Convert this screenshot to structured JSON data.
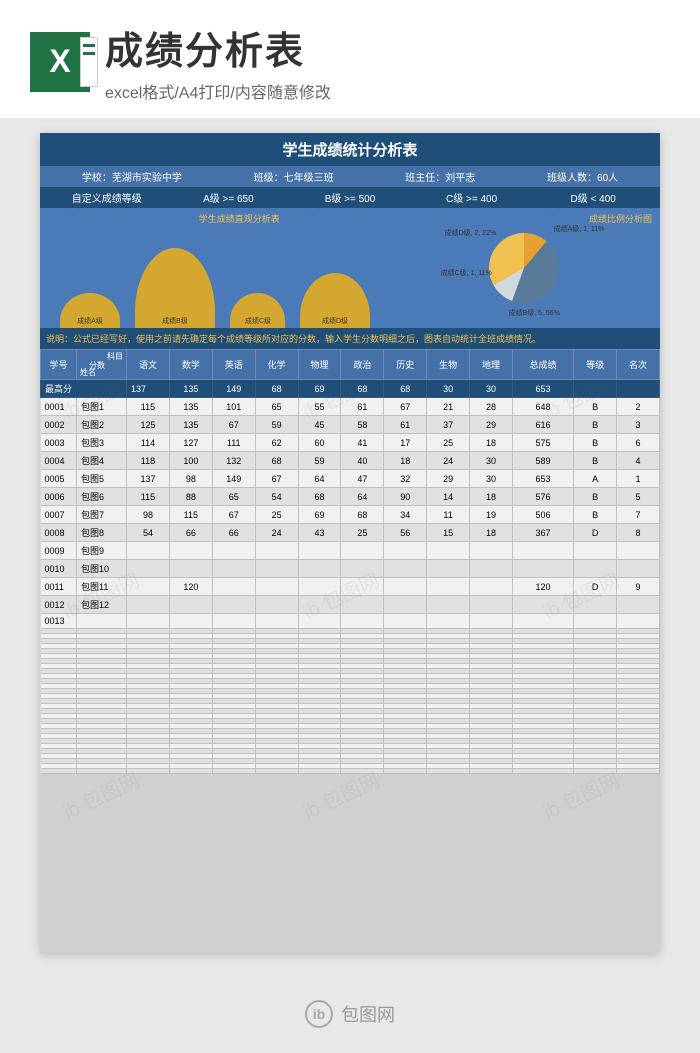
{
  "banner": {
    "title": "成绩分析表",
    "subtitle": "excel格式/A4打印/内容随意修改",
    "icon_letter": "X"
  },
  "sheet": {
    "title": "学生成绩统计分析表",
    "info": {
      "school_label": "学校：芜湖市实验中学",
      "class_label": "班级：七年级三班",
      "teacher_label": "班主任：刘平志",
      "count_label": "班级人数：60人"
    },
    "levels": {
      "custom": "自定义成绩等级",
      "a": "A级 >= 650",
      "b": "B级 >= 500",
      "c": "C级 >= 400",
      "d": "D级 < 400"
    },
    "chart": {
      "area_title": "学生成绩直观分析表",
      "pie_title": "成绩比例分析图",
      "pie_labels": {
        "a": "成绩A级, 1, 11%",
        "b": "成绩B级, 5, 56%",
        "c": "成绩C级, 1, 11%",
        "d": "成绩D级, 2, 22%"
      },
      "hump_labels": [
        "成绩A级",
        "成绩B级",
        "成绩C级",
        "成绩D级"
      ]
    },
    "note": "说明：公式已经写好，使用之前请先确定每个成绩等级所对应的分数，输入学生分数明细之后，图表自动统计全班成绩情况。",
    "headers": {
      "id": "学号",
      "diag_top": "科目",
      "diag_mid": "分数",
      "diag_bot": "姓名",
      "subjects": [
        "语文",
        "数学",
        "英语",
        "化学",
        "物理",
        "政治",
        "历史",
        "生物",
        "地理"
      ],
      "total": "总成绩",
      "level": "等级",
      "rank": "名次"
    },
    "max_row": {
      "label": "最高分",
      "values": [
        "137",
        "135",
        "149",
        "68",
        "69",
        "68",
        "68",
        "30",
        "30",
        "653",
        "",
        ""
      ]
    },
    "rows": [
      {
        "id": "0001",
        "name": "包图1",
        "v": [
          "115",
          "135",
          "101",
          "65",
          "55",
          "61",
          "67",
          "21",
          "28",
          "648",
          "B",
          "2"
        ]
      },
      {
        "id": "0002",
        "name": "包图2",
        "v": [
          "125",
          "135",
          "67",
          "59",
          "45",
          "58",
          "61",
          "37",
          "29",
          "616",
          "B",
          "3"
        ]
      },
      {
        "id": "0003",
        "name": "包图3",
        "v": [
          "114",
          "127",
          "111",
          "62",
          "60",
          "41",
          "17",
          "25",
          "18",
          "575",
          "B",
          "6"
        ]
      },
      {
        "id": "0004",
        "name": "包图4",
        "v": [
          "118",
          "100",
          "132",
          "68",
          "59",
          "40",
          "18",
          "24",
          "30",
          "589",
          "B",
          "4"
        ]
      },
      {
        "id": "0005",
        "name": "包图5",
        "v": [
          "137",
          "98",
          "149",
          "67",
          "64",
          "47",
          "32",
          "29",
          "30",
          "653",
          "A",
          "1"
        ]
      },
      {
        "id": "0006",
        "name": "包图6",
        "v": [
          "115",
          "88",
          "65",
          "54",
          "68",
          "64",
          "90",
          "14",
          "18",
          "576",
          "B",
          "5"
        ]
      },
      {
        "id": "0007",
        "name": "包图7",
        "v": [
          "98",
          "115",
          "67",
          "25",
          "69",
          "68",
          "34",
          "11",
          "19",
          "506",
          "B",
          "7"
        ]
      },
      {
        "id": "0008",
        "name": "包图8",
        "v": [
          "54",
          "66",
          "66",
          "24",
          "43",
          "25",
          "56",
          "15",
          "18",
          "367",
          "D",
          "8"
        ]
      },
      {
        "id": "0009",
        "name": "包图9",
        "v": [
          "",
          "",
          "",
          "",
          "",
          "",
          "",
          "",
          "",
          "",
          "",
          ""
        ]
      },
      {
        "id": "0010",
        "name": "包图10",
        "v": [
          "",
          "",
          "",
          "",
          "",
          "",
          "",
          "",
          "",
          "",
          "",
          ""
        ]
      },
      {
        "id": "0011",
        "name": "包图11",
        "v": [
          "",
          "120",
          "",
          "",
          "",
          "",
          "",
          "",
          "",
          "120",
          "D",
          "9"
        ]
      },
      {
        "id": "0012",
        "name": "包图12",
        "v": [
          "",
          "",
          "",
          "",
          "",
          "",
          "",
          "",
          "",
          "",
          "",
          ""
        ]
      },
      {
        "id": "0013",
        "name": "",
        "v": [
          "",
          "",
          "",
          "",
          "",
          "",
          "",
          "",
          "",
          "",
          "",
          ""
        ]
      }
    ]
  },
  "footer": {
    "logo_char": "ib",
    "text": "包图网"
  },
  "chart_data": [
    {
      "type": "pie",
      "title": "成绩比例分析图",
      "categories": [
        "成绩A级",
        "成绩B级",
        "成绩C级",
        "成绩D级"
      ],
      "values": [
        1,
        5,
        1,
        2
      ],
      "percentages": [
        11,
        56,
        11,
        22
      ]
    },
    {
      "type": "area",
      "title": "学生成绩直观分析表",
      "categories": [
        "成绩A级",
        "成绩B级",
        "成绩C级",
        "成绩D级"
      ],
      "values": [
        1,
        5,
        1,
        2
      ]
    }
  ]
}
